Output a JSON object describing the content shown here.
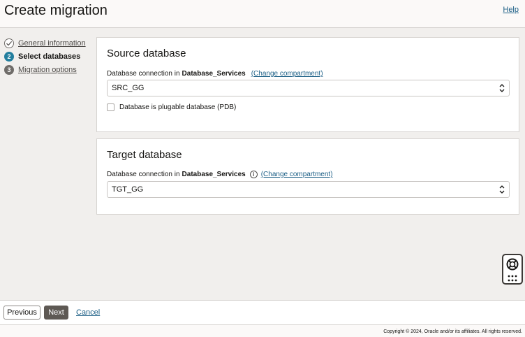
{
  "header": {
    "title": "Create migration",
    "help_label": "Help"
  },
  "steps": [
    {
      "number": "",
      "label": "General information",
      "state": "done"
    },
    {
      "number": "2",
      "label": "Select databases",
      "state": "current"
    },
    {
      "number": "3",
      "label": "Migration options",
      "state": "todo"
    }
  ],
  "source": {
    "title": "Source database",
    "connection_label": "Database connection in",
    "compartment": "Database_Services",
    "change_compartment": "(Change compartment)",
    "selected_connection": "SRC_GG",
    "pdb_checkbox_label": "Database is plugable database (PDB)",
    "pdb_checked": false
  },
  "target": {
    "title": "Target database",
    "connection_label": "Database connection in",
    "compartment": "Database_Services",
    "info_icon": "i",
    "change_compartment": "(Change compartment)",
    "selected_connection": "TGT_GG"
  },
  "footer": {
    "previous_label": "Previous",
    "next_label": "Next",
    "cancel_label": "Cancel"
  },
  "copyright": "Copyright © 2024, Oracle and/or its affiliates. All rights reserved.",
  "colors": {
    "link": "#1c5f86",
    "current_step": "#227e9e",
    "next_button": "#5e5954"
  },
  "icons": {
    "step_done": "check-circle-icon",
    "help_widget": "lifebuoy-icon",
    "help_widget_menu": "grid-dots-icon"
  }
}
